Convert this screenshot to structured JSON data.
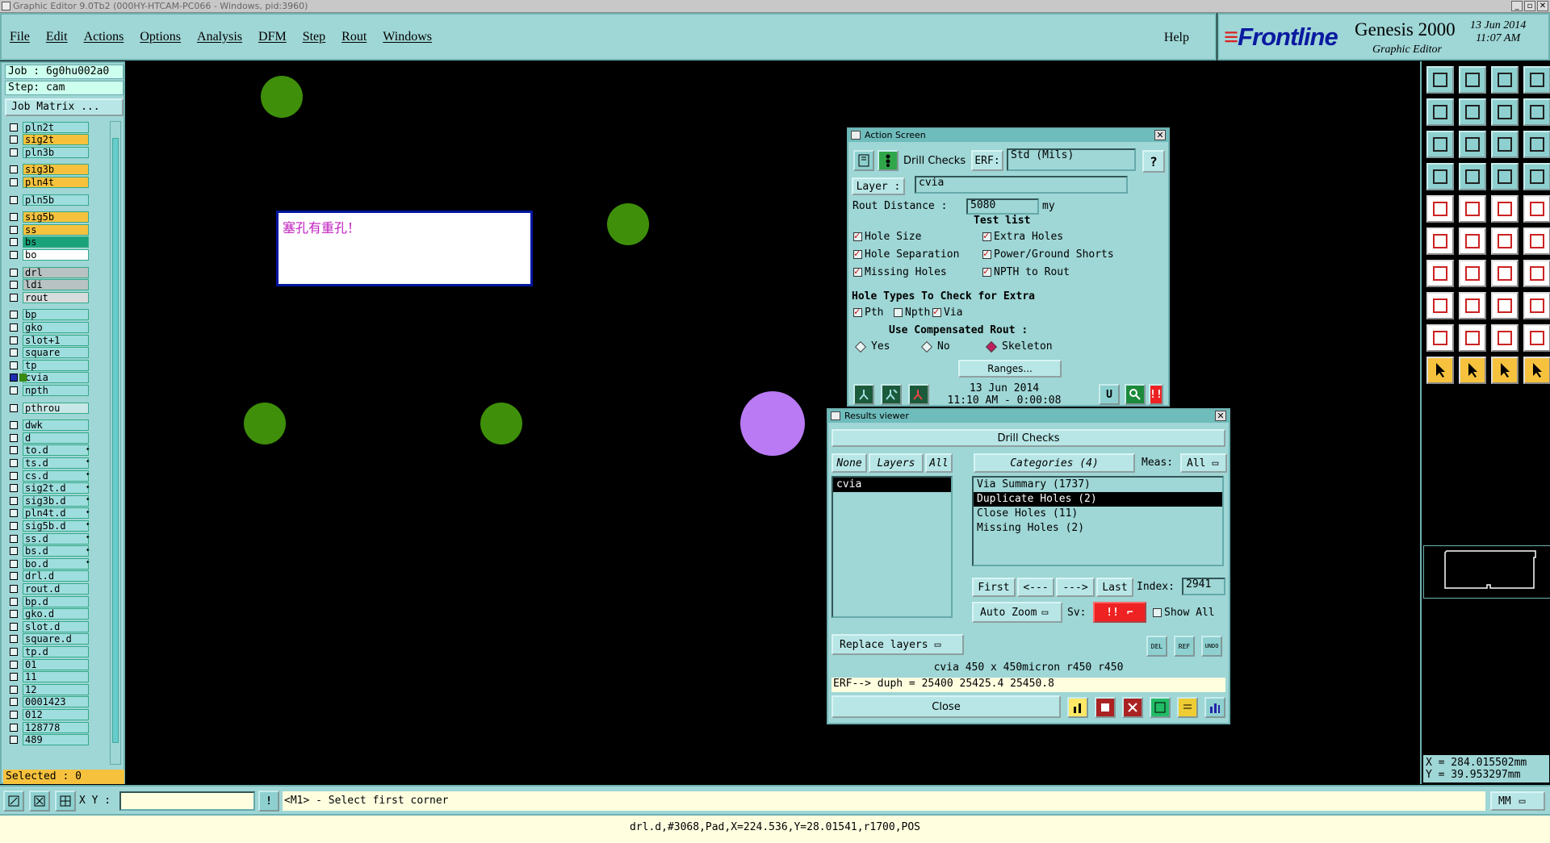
{
  "window": {
    "title": "Graphic Editor 9.0Tb2 (000HY-HTCAM-PC066 - Windows, pid:3960)"
  },
  "menu": {
    "items": [
      "File",
      "Edit",
      "Actions",
      "Options",
      "Analysis",
      "DFM",
      "Step",
      "Rout",
      "Windows"
    ],
    "help": "Help"
  },
  "brand": {
    "logo": "Frontline",
    "product": "Genesis 2000",
    "subtitle": "Graphic Editor",
    "date": "13 Jun 2014",
    "time": "11:07 AM"
  },
  "job": {
    "job_label": "Job : 6g0hu002a0",
    "step_label": "Step: cam",
    "job_matrix": "Job Matrix ...",
    "selected": "Selected : 0"
  },
  "layers": [
    {
      "name": "pln2t",
      "color": "#9fdede"
    },
    {
      "name": "sig2t",
      "color": "#f6c23e"
    },
    {
      "name": "pln3b",
      "color": "#9fdede"
    },
    {
      "name": "sig3b",
      "color": "#f6c23e"
    },
    {
      "name": "pln4t",
      "color": "#f6c23e"
    },
    {
      "name": "pln5b",
      "color": "#9fdede"
    },
    {
      "name": "sig5b",
      "color": "#f6c23e"
    },
    {
      "name": "ss",
      "color": "#f6c23e"
    },
    {
      "name": "bs",
      "color": "#1aa37a"
    },
    {
      "name": "bo",
      "color": "#ffffff"
    },
    {
      "name": "drl",
      "color": "#b9c2c2"
    },
    {
      "name": "ldi",
      "color": "#b9c2c2"
    },
    {
      "name": "rout",
      "color": "#d8dcdc"
    },
    {
      "name": "bp",
      "color": "#9fdede"
    },
    {
      "name": "gko",
      "color": "#9fdede"
    },
    {
      "name": "slot+1",
      "color": "#9fdede"
    },
    {
      "name": "square",
      "color": "#9fdede"
    },
    {
      "name": "tp",
      "color": "#9fdede"
    },
    {
      "name": "cvia",
      "color": "#9fdede"
    },
    {
      "name": "npth",
      "color": "#9fdede"
    },
    {
      "name": "pthrou",
      "color": "#c8e8e8"
    },
    {
      "name": "dwk",
      "color": "#9fdede"
    },
    {
      "name": "d",
      "color": "#9fdede"
    },
    {
      "name": "to.d",
      "color": "#9fdede"
    },
    {
      "name": "ts.d",
      "color": "#9fdede"
    },
    {
      "name": "cs.d",
      "color": "#9fdede"
    },
    {
      "name": "sig2t.d",
      "color": "#9fdede"
    },
    {
      "name": "sig3b.d",
      "color": "#9fdede"
    },
    {
      "name": "pln4t.d",
      "color": "#9fdede"
    },
    {
      "name": "sig5b.d",
      "color": "#9fdede"
    },
    {
      "name": "ss.d",
      "color": "#9fdede"
    },
    {
      "name": "bs.d",
      "color": "#9fdede"
    },
    {
      "name": "bo.d",
      "color": "#9fdede"
    },
    {
      "name": "drl.d",
      "color": "#9fdede"
    },
    {
      "name": "rout.d",
      "color": "#9fdede"
    },
    {
      "name": "bp.d",
      "color": "#9fdede"
    },
    {
      "name": "gko.d",
      "color": "#9fdede"
    },
    {
      "name": "slot.d",
      "color": "#9fdede"
    },
    {
      "name": "square.d",
      "color": "#9fdede"
    },
    {
      "name": "tp.d",
      "color": "#9fdede"
    },
    {
      "name": "01",
      "color": "#9fdede"
    },
    {
      "name": "11",
      "color": "#9fdede"
    },
    {
      "name": "12",
      "color": "#9fdede"
    },
    {
      "name": "0001423",
      "color": "#9fdede"
    },
    {
      "name": "012",
      "color": "#9fdede"
    },
    {
      "name": "128778",
      "color": "#9fdede"
    },
    {
      "name": "489",
      "color": "#9fdede"
    }
  ],
  "canvas": {
    "message": "塞孔有重孔！",
    "pad_green": "#3f8f0a",
    "pad_purple": "#b97af4"
  },
  "action_screen": {
    "title": "Action Screen",
    "check_name": "Drill Checks",
    "erf_label": "ERF:",
    "erf_value": "Std (Mils)",
    "layer_label": "Layer :",
    "layer_value": "cvia",
    "rout_label": "Rout Distance :",
    "rout_value": "5080",
    "rout_unit": "my",
    "test_list": "Test list",
    "tests": [
      {
        "label": "Hole Size",
        "checked": true
      },
      {
        "label": "Extra Holes",
        "checked": true
      },
      {
        "label": "Hole Separation",
        "checked": true
      },
      {
        "label": "Power/Ground Shorts",
        "checked": true
      },
      {
        "label": "Missing Holes",
        "checked": true
      },
      {
        "label": "NPTH to Rout",
        "checked": true
      }
    ],
    "hole_types_label": "Hole Types To Check for Extra",
    "hole_types": [
      {
        "label": "Pth",
        "checked": true
      },
      {
        "label": "Npth",
        "checked": false
      },
      {
        "label": "Via",
        "checked": true
      }
    ],
    "comp_rout_label": "Use Compensated Rout :",
    "comp_rout_options": [
      {
        "label": "Yes",
        "selected": false
      },
      {
        "label": "No",
        "selected": false
      },
      {
        "label": "Skeleton",
        "selected": true
      }
    ],
    "ranges_button": "Ranges...",
    "run_date": "13 Jun 2014",
    "run_time": "11:10 AM - 0:00:08"
  },
  "results_viewer": {
    "title": "Results viewer",
    "header": "Drill Checks",
    "none_btn": "None",
    "layers_btn": "Layers",
    "all_btn": "All",
    "categories_btn": "Categories (4)",
    "meas_label": "Meas:",
    "meas_value": "All",
    "layer_items": [
      "cvia"
    ],
    "categories": [
      {
        "label": "Via Summary (1737)",
        "selected": false
      },
      {
        "label": "Duplicate Holes (2)",
        "selected": true
      },
      {
        "label": "Close Holes (11)",
        "selected": false
      },
      {
        "label": "Missing Holes (2)",
        "selected": false
      }
    ],
    "first_btn": "First",
    "prev_btn": "<---",
    "next_btn": "--->",
    "last_btn": "Last",
    "index_label": "Index:",
    "index_value": "2941",
    "auto_zoom": "Auto Zoom",
    "sv_label": "Sv:",
    "sv_value": "!!",
    "show_all": "Show All",
    "replace_layers": "Replace layers",
    "small_btns": [
      "DEL",
      "REF",
      "UNDO"
    ],
    "info_line": "cvia 450 x 450micron  r450  r450",
    "erf_line": "ERF--> duph = 25400 25425.4 25450.8",
    "close_btn": "Close"
  },
  "bottom": {
    "xy_label": "X Y :",
    "xy_value": "",
    "prompt": "<M1> - Select first corner",
    "units": "MM"
  },
  "status": {
    "text": "drl.d,#3068,Pad,X=224.536,Y=28.01541,r1700,POS"
  },
  "coords": {
    "x": "X = 284.015502mm",
    "y": "Y = 39.953297mm"
  }
}
